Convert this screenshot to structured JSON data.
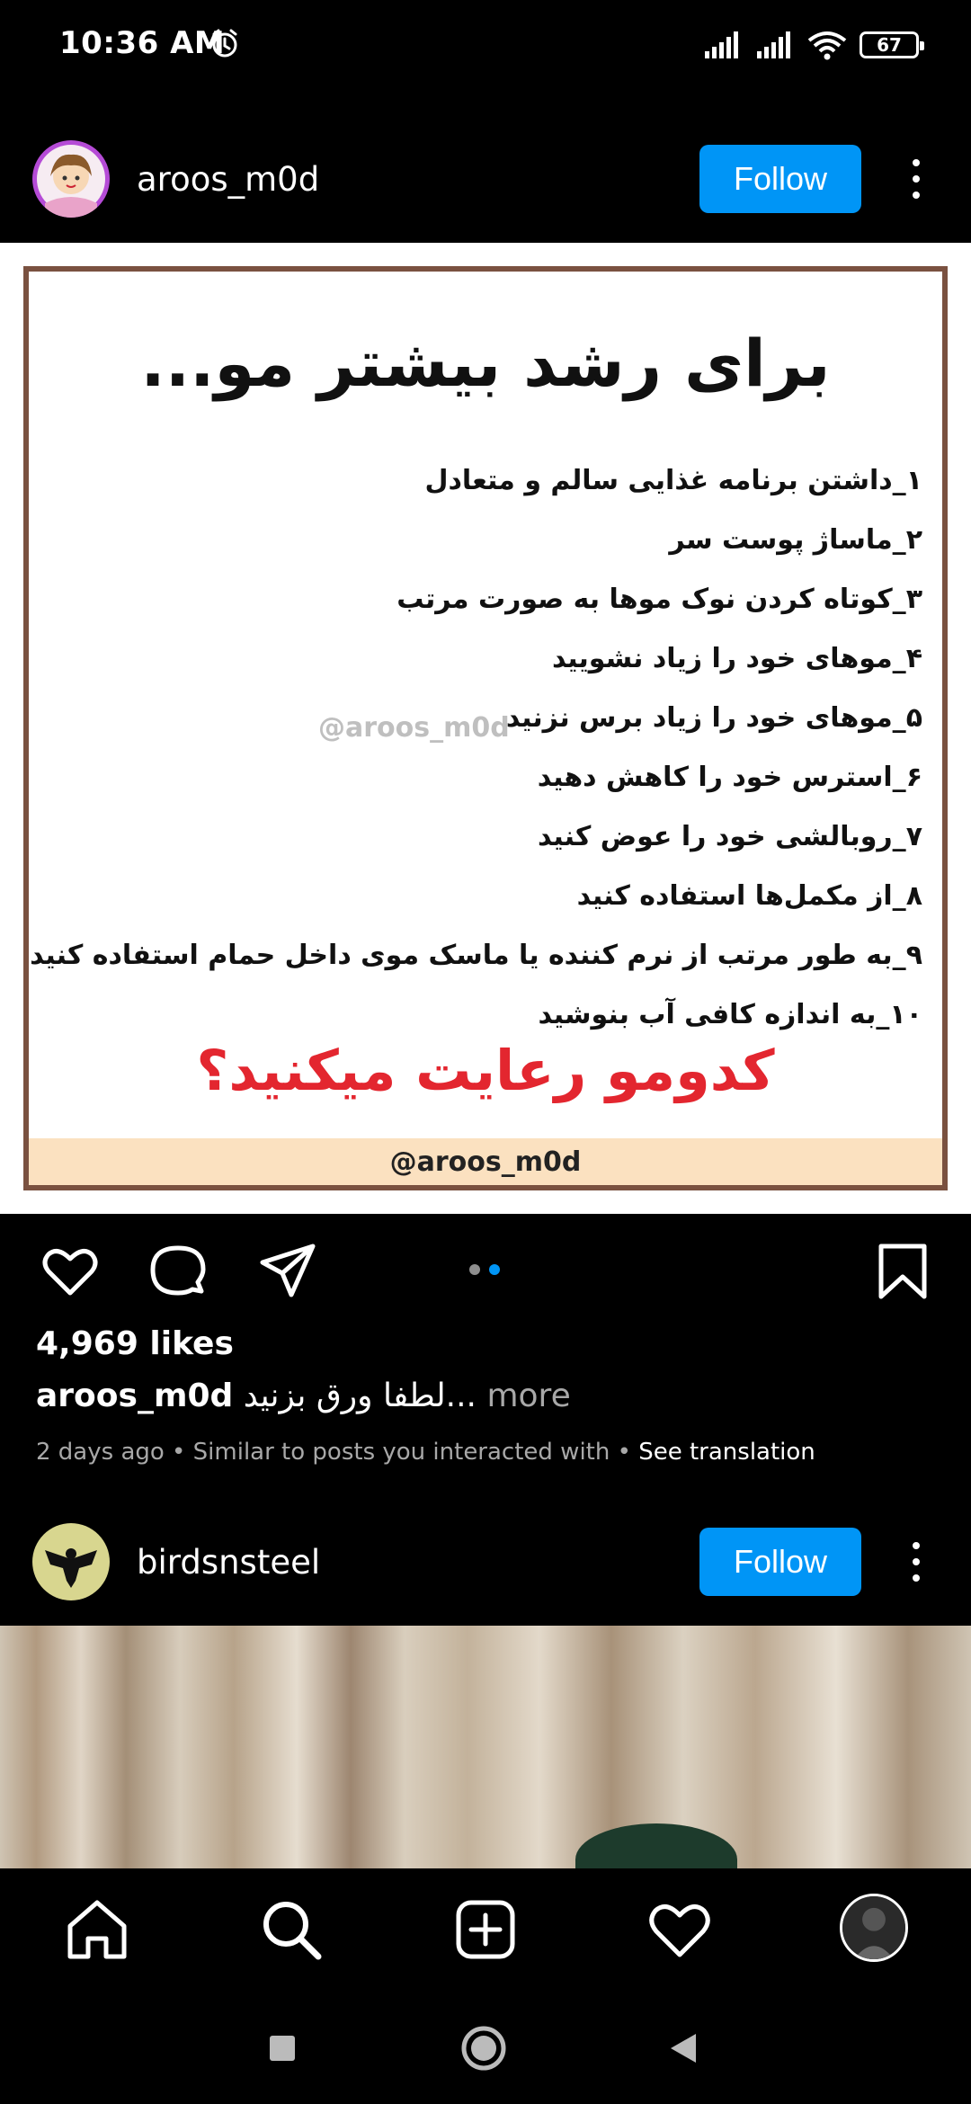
{
  "status": {
    "time": "10:36 AM",
    "battery": "67"
  },
  "post1": {
    "username": "aroos_m0d",
    "follow_label": "Follow",
    "image": {
      "title": "برای رشد بیشتر مو...",
      "tips": [
        "۱_داشتن برنامه غذایی سالم و متعادل",
        "۲_ماساژ پوست سر",
        "۳_کوتاه کردن نوک موها به صورت مرتب",
        "۴_موهای خود را زیاد نشویید",
        "۵_موهای خود را زیاد برس نزنید",
        "۶_استرس خود را کاهش دهید",
        "۷_روبالشی خود را عوض کنید",
        "۸_از مکمل‌ها استفاده کنید",
        "۹_به طور مرتب از نرم کننده یا ماسک موی داخل حمام استفاده کنید",
        "۱۰_به اندازه کافی آب بنوشید"
      ],
      "watermark": "@aroos_m0d",
      "question": "کدومو رعایت میکنید؟",
      "footer": "@aroos_m0d"
    },
    "likes": "4,969 likes",
    "caption_user": "aroos_m0d",
    "caption_text": "لطفا ورق بزنید...",
    "caption_more": " more",
    "meta_time": "2 days ago",
    "meta_similar": " • Similar to posts you interacted with • ",
    "meta_translate": "See translation"
  },
  "post2": {
    "username": "birdsnsteel",
    "follow_label": "Follow"
  },
  "colors": {
    "follow_blue": "#0095f6",
    "frame_brown": "#7a5140",
    "question_red": "#e3262f",
    "footer_band": "#fbe1c0"
  }
}
